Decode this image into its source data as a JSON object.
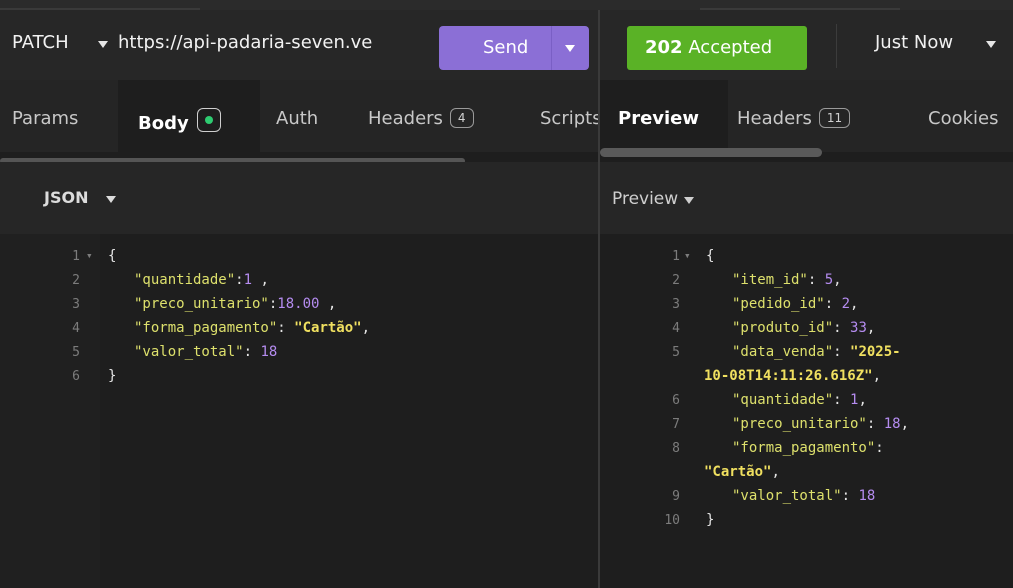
{
  "request": {
    "method": "PATCH",
    "url": "https://api-padaria-seven.ve",
    "send_label": "Send"
  },
  "request_tabs": {
    "params": "Params",
    "body": "Body",
    "auth": "Auth",
    "headers": "Headers",
    "headers_count": "4",
    "scripts": "Scripts"
  },
  "body_format": "JSON",
  "request_body": [
    {
      "ln": "1",
      "key": "",
      "val": "",
      "open": "{",
      "close": ""
    },
    {
      "ln": "2",
      "key": "\"quantidade\"",
      "sep": ":",
      "val": "1",
      "type": "num",
      "tail": " ,"
    },
    {
      "ln": "3",
      "key": "\"preco_unitario\"",
      "sep": ":",
      "val": "18.00",
      "type": "num",
      "tail": " ,"
    },
    {
      "ln": "4",
      "key": "\"forma_pagamento\"",
      "sep": ": ",
      "val": "\"Cartão\"",
      "type": "str",
      "tail": ","
    },
    {
      "ln": "5",
      "key": "\"valor_total\"",
      "sep": ": ",
      "val": "18",
      "type": "num",
      "tail": ""
    },
    {
      "ln": "6",
      "close": "}"
    }
  ],
  "response": {
    "status_code": "202",
    "status_text": "Accepted",
    "time": "Just Now"
  },
  "response_tabs": {
    "preview": "Preview",
    "headers": "Headers",
    "headers_count": "11",
    "cookies": "Cookies"
  },
  "preview_label": "Preview",
  "response_body": {
    "l1": "{",
    "item_id_key": "\"item_id\"",
    "item_id_val": "5",
    "pedido_id_key": "\"pedido_id\"",
    "pedido_id_val": "2",
    "produto_id_key": "\"produto_id\"",
    "produto_id_val": "33",
    "data_venda_key": "\"data_venda\"",
    "data_venda_val_a": "\"2025-",
    "data_venda_val_b": "10-08T14:11:26.616Z\"",
    "quantidade_key": "\"quantidade\"",
    "quantidade_val": "1",
    "preco_key": "\"preco_unitario\"",
    "preco_val": "18",
    "forma_key": "\"forma_pagamento\"",
    "forma_val": "\"Cartão\"",
    "valor_key": "\"valor_total\"",
    "valor_val": "18",
    "close": "}"
  },
  "line_numbers": {
    "l1": "1",
    "l2": "2",
    "l3": "3",
    "l4": "4",
    "l5": "5",
    "l6": "6",
    "l7": "7",
    "l8": "8",
    "l9": "9",
    "l10": "10"
  }
}
